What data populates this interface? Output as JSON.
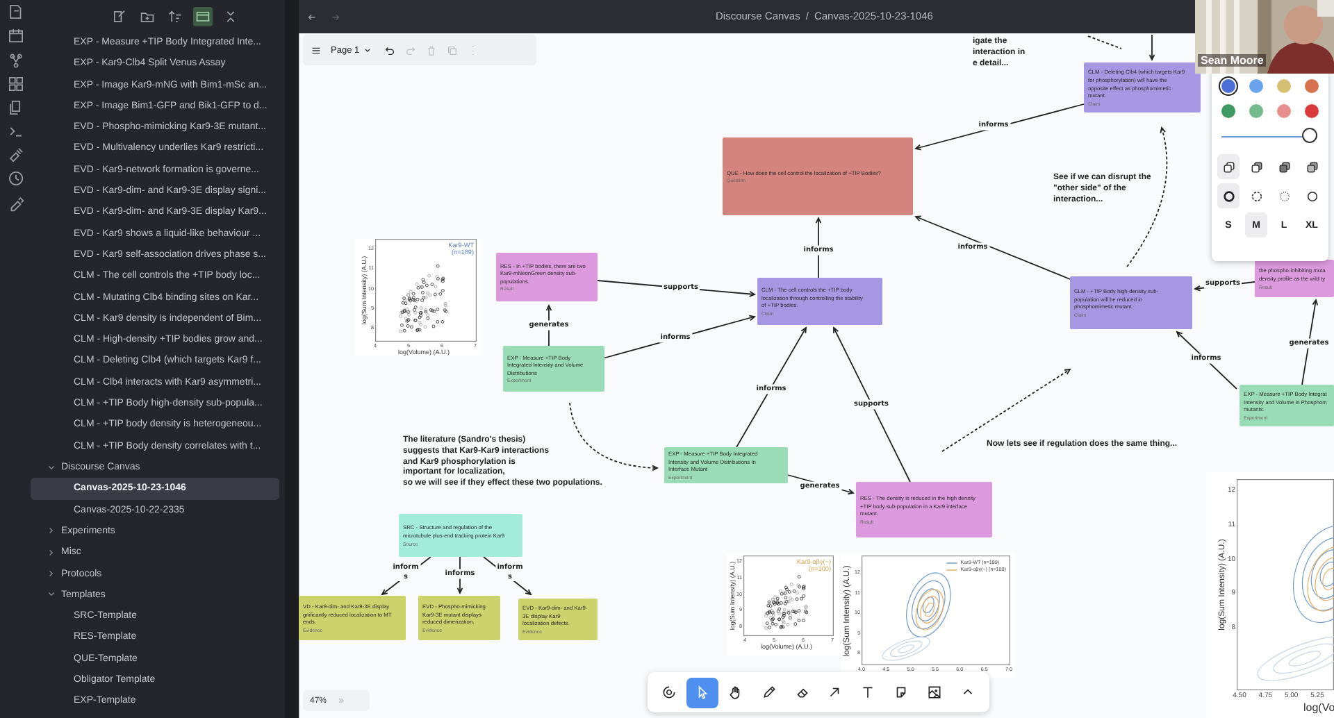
{
  "sidebar": {
    "toolbar": [
      {
        "kind": "new-note",
        "on": false
      },
      {
        "kind": "new-folder",
        "on": false
      },
      {
        "kind": "sort",
        "on": false
      },
      {
        "kind": "auto-reveal",
        "on": true
      },
      {
        "kind": "collapse",
        "on": false
      }
    ],
    "loose_items": [
      {
        "label": "EXP - Measure +TIP Body Integrated Inte...",
        "selected": false
      },
      {
        "label": "EXP - Kar9-Clb4 Split Venus Assay",
        "selected": false
      },
      {
        "label": "EXP - Image Kar9-mNG with Bim1-mSc an...",
        "selected": false
      },
      {
        "label": "EXP - Image Bim1-GFP and Bik1-GFP to d...",
        "selected": false
      },
      {
        "label": "EVD - Phospho-mimicking Kar9-3E mutant...",
        "selected": false
      },
      {
        "label": "EVD - Multivalency underlies Kar9 restricti...",
        "selected": false
      },
      {
        "label": "EVD - Kar9-network formation is governe...",
        "selected": false
      },
      {
        "label": "EVD - Kar9-dim- and Kar9-3E display signi...",
        "selected": false
      },
      {
        "label": "EVD - Kar9-dim- and Kar9-3E display Kar9...",
        "selected": false
      },
      {
        "label": "EVD - Kar9 shows a liquid-like behaviour ...",
        "selected": false
      },
      {
        "label": "EVD - Kar9 self-association drives phase s...",
        "selected": false
      },
      {
        "label": "CLM - The cell controls the +TIP body loc...",
        "selected": false
      },
      {
        "label": "CLM - Mutating Clb4 binding sites on Kar...",
        "selected": false
      },
      {
        "label": "CLM - Kar9 density is independent of Bim...",
        "selected": false
      },
      {
        "label": "CLM - High-density +TIP bodies grow and...",
        "selected": false
      },
      {
        "label": "CLM - Deleting Clb4 (which targets Kar9 f...",
        "selected": false
      },
      {
        "label": "CLM - Clb4 interacts with Kar9 asymmetri...",
        "selected": false
      },
      {
        "label": "CLM - +TIP Body high-density sub-popula...",
        "selected": false
      },
      {
        "label": "CLM - +TIP body density is heterogeneou...",
        "selected": false
      },
      {
        "label": "CLM - +TIP Body density correlates with t...",
        "selected": false
      }
    ],
    "folders": [
      {
        "label": "Discourse Canvas",
        "expanded": true,
        "children": [
          {
            "label": "Canvas-2025-10-23-1046",
            "selected": true
          },
          {
            "label": "Canvas-2025-10-22-2335",
            "selected": false
          }
        ]
      },
      {
        "label": "Experiments",
        "expanded": false
      },
      {
        "label": "Misc",
        "expanded": false
      },
      {
        "label": "Protocols",
        "expanded": false
      },
      {
        "label": "Templates",
        "expanded": true,
        "children": [
          {
            "label": "SRC-Template",
            "selected": false
          },
          {
            "label": "RES-Template",
            "selected": false
          },
          {
            "label": "QUE-Template",
            "selected": false
          },
          {
            "label": "Obligator Template",
            "selected": false
          },
          {
            "label": "EXP-Template",
            "selected": false
          }
        ]
      }
    ]
  },
  "header": {
    "back_disabled": false,
    "forward_disabled": true,
    "separator": "/",
    "breadcrumb": [
      "Discourse Canvas",
      "Canvas-2025-10-23-1046"
    ]
  },
  "canvas_toolbar": {
    "page": "Page 1",
    "actions": [
      {
        "kind": "undo",
        "disabled": false
      },
      {
        "kind": "redo",
        "disabled": true
      },
      {
        "kind": "delete",
        "disabled": true
      },
      {
        "kind": "duplicate",
        "disabled": true
      },
      {
        "kind": "more",
        "disabled": false
      }
    ]
  },
  "nodes": [
    {
      "kind": "question",
      "text": "QUE - How does the cell control the localization of +TIP Bodies?",
      "type": "Question"
    },
    {
      "kind": "claim",
      "text": "CLM - Deleting Clb4 (which targets Kar9\nfor phosphorylation) will have the\nopposite effect as phosphomimetic\nmutant.",
      "type": "Claim"
    },
    {
      "kind": "claim",
      "text": "CLM - The cell controls the +TIP body\nlocalization through controlling the stability\nof +TIP bodies.",
      "type": "Claim"
    },
    {
      "kind": "result",
      "text": "RES - In +TIP bodies, there are two\nKar9-mNeonGreen density sub-\npopulations.",
      "type": "Result"
    },
    {
      "kind": "experiment",
      "text": "EXP - Measure +TIP Body\nIntegrated Intensity and Volume\nDistributions",
      "type": "Experiment"
    },
    {
      "kind": "claim",
      "text": "CLM - +TIP Body high-density sub-\npopulation will be reduced in\nphosphomimetic mutant.",
      "type": "Claim"
    },
    {
      "kind": "result",
      "text": "the phospho-inhibiting muta\ndensity profile as the wild ty",
      "type": "Result"
    },
    {
      "kind": "experiment",
      "text": "EXP - Measure +TIP Body Integrat\nIntensity and Volume in Phosphom\nmutants.",
      "type": "Experiment"
    },
    {
      "kind": "experiment",
      "text": "EXP - Measure +TIP Body Integrated\nIntensity and Volume Distributions In\nInterface Mutant",
      "type": "Experiment"
    },
    {
      "kind": "result",
      "text": "RES - The density is reduced in the high density\n+TIP body sub-population in a Kar9 interface\nmutant.",
      "type": "Result"
    },
    {
      "kind": "source",
      "text": "SRC - Structure and regulation of the\nmicrotubule plus-end tracking protein Kar9",
      "type": "Source"
    },
    {
      "kind": "evidence",
      "text": "VD - Kar9-dim- and Kar9-3E display\ngnificantly reduced localization to MT\nends.",
      "type": "Evidence"
    },
    {
      "kind": "evidence",
      "text": "EVD - Phospho-mimicking\nKar9-3E mutant displays\nreduced dimerization.",
      "type": "Evidence"
    },
    {
      "kind": "evidence",
      "text": "EVD - Kar9-dim- and Kar9-\n3E display Kar9\nlocalization defects.",
      "type": "Evidence"
    }
  ],
  "edges": [
    {
      "label": "informs"
    },
    {
      "label": "supports"
    },
    {
      "label": "informs"
    },
    {
      "label": "generates"
    },
    {
      "label": "informs"
    },
    {
      "label": "supports"
    },
    {
      "label": "generates"
    },
    {
      "label": "informs"
    },
    {
      "label": "informs"
    },
    {
      "label": "supports"
    },
    {
      "label": "generates"
    },
    {
      "label": "informs"
    },
    {
      "label": "inform\ns"
    },
    {
      "label": "informs"
    },
    {
      "label": "inform\ns"
    }
  ],
  "notes": [
    "igate the\ninteraction in\ne detail...",
    "See if we can disrupt the\n\"other side\" of the\ninteraction...",
    "The literature (Sandro's thesis)\nsuggests that Kar9-Kar9 interactions\nand Kar9 phosphorylation is\nimportant for localization,\nso we will see if they effect these two populations.",
    "Now lets see if regulation does the same thing..."
  ],
  "plots": [
    {
      "kind": "scatter",
      "title": "Kar9-WT\n(n=189)",
      "ylabel": "log(Sum Intensity) (A.U.)",
      "xlabel": "log(Volume) (A.U.)",
      "xticks": [
        "4",
        "5",
        "6",
        "7"
      ],
      "yticks": [
        "12",
        "11",
        "10",
        "9",
        "8"
      ]
    },
    {
      "kind": "scatter",
      "title": "Kar9-αβγ(−)\n(n=100)",
      "ylabel": "log(Sum Intensity) (A.U.)",
      "xlabel": "log(Volume) (A.U.)",
      "xticks": [
        "4",
        "5",
        "6",
        "7"
      ],
      "yticks": [
        "12",
        "11",
        "10",
        "9",
        "8"
      ]
    },
    {
      "kind": "contour",
      "legend": [
        "Kar9-WT (n=189)",
        "Kar9-αβγ(−) (n=100)"
      ],
      "ylabel": "log(Sum Intensity) (A.U.)",
      "xticks": [
        "4.0",
        "4.5",
        "5.0",
        "5.5",
        "6.0",
        "6.5",
        "7.0"
      ],
      "yticks": [
        "12",
        "11",
        "10",
        "9",
        "8"
      ]
    },
    {
      "kind": "contour",
      "ylabel": "log(Sum Intensity) (A.U.)",
      "xlabel": "log(Vo",
      "xticks": [
        "4.50",
        "4.75",
        "5.00",
        "5.25"
      ],
      "yticks": [
        "12",
        "11",
        "10",
        "9",
        "8"
      ]
    }
  ],
  "video": {
    "name": "Sean Moore"
  },
  "style_panel": {
    "colors": [
      {
        "color": "#4a6fd8",
        "selected": true
      },
      {
        "color": "#6aa3ee",
        "selected": false
      },
      {
        "color": "#d6c073",
        "selected": false
      },
      {
        "color": "#d8714e",
        "selected": false
      },
      {
        "color": "#3f9a64",
        "selected": false
      },
      {
        "color": "#72b98c",
        "selected": false
      },
      {
        "color": "#e98e8e",
        "selected": false
      },
      {
        "color": "#dc3b3b",
        "selected": false
      }
    ],
    "opacity": {
      "level": 1
    },
    "fills": [
      {
        "kind": "none",
        "selected": true
      },
      {
        "kind": "semi",
        "selected": false
      },
      {
        "kind": "solid",
        "selected": false
      },
      {
        "kind": "pattern",
        "selected": false
      }
    ],
    "dashes": [
      {
        "kind": "draw",
        "selected": true
      },
      {
        "kind": "dashed",
        "selected": false
      },
      {
        "kind": "dotted",
        "selected": false
      },
      {
        "kind": "solid",
        "selected": false
      }
    ],
    "sizes": [
      {
        "label": "S",
        "selected": false
      },
      {
        "label": "M",
        "selected": true
      },
      {
        "label": "L",
        "selected": false
      },
      {
        "label": "XL",
        "selected": false
      }
    ]
  },
  "zoom": "47%",
  "tools": [
    {
      "kind": "discourse",
      "selected": false
    },
    {
      "kind": "select",
      "selected": true
    },
    {
      "kind": "hand",
      "selected": false
    },
    {
      "kind": "draw",
      "selected": false
    },
    {
      "kind": "eraser",
      "selected": false
    },
    {
      "kind": "arrow",
      "selected": false
    },
    {
      "kind": "text",
      "selected": false
    },
    {
      "kind": "note",
      "selected": false
    },
    {
      "kind": "media",
      "selected": false
    },
    {
      "kind": "more",
      "selected": false
    }
  ]
}
